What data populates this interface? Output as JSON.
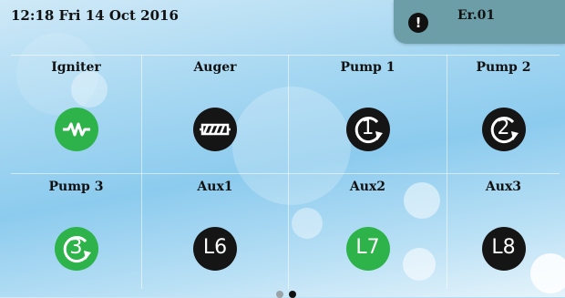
{
  "status": {
    "datetime": "12:18 Fri 14 Oct 2016"
  },
  "alarm": {
    "code": "Er.01",
    "icon": "alert-icon"
  },
  "outputs": [
    {
      "label": "Igniter",
      "icon": "resistor-icon",
      "color": "#2db34a"
    },
    {
      "label": "Auger",
      "icon": "auger-icon",
      "color": "#151515"
    },
    {
      "label": "Pump 1",
      "icon": "pump-1-icon",
      "color": "#151515",
      "glyph": "1"
    },
    {
      "label": "Pump 2",
      "icon": "pump-2-icon",
      "color": "#151515",
      "glyph": "2"
    },
    {
      "label": "Pump 3",
      "icon": "pump-3-icon",
      "color": "#2db34a",
      "glyph": "3"
    },
    {
      "label": "Aux1",
      "icon": "aux-l6-icon",
      "color": "#151515",
      "glyph": "L6"
    },
    {
      "label": "Aux2",
      "icon": "aux-l7-icon",
      "color": "#2db34a",
      "glyph": "L7"
    },
    {
      "label": "Aux3",
      "icon": "aux-l8-icon",
      "color": "#151515",
      "glyph": "L8"
    }
  ],
  "pager": {
    "pages": 2,
    "current": 2
  }
}
